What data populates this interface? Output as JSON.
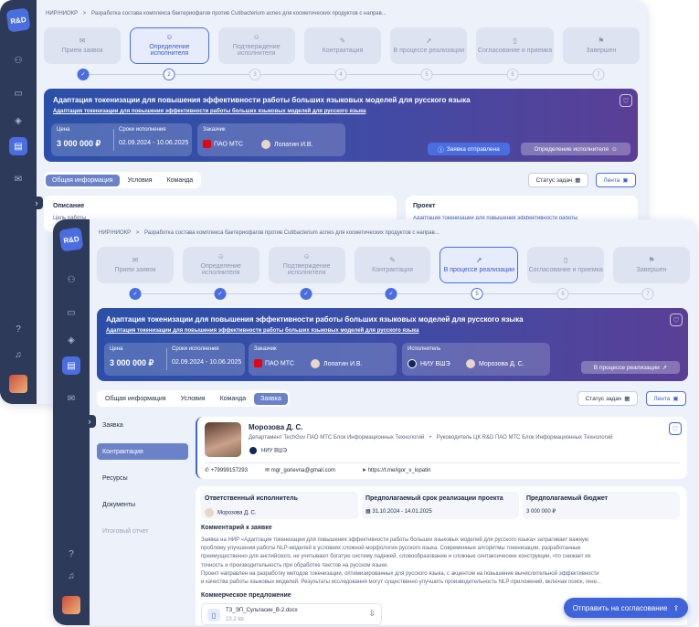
{
  "app": {
    "logo": "R&D"
  },
  "breadcrumb": {
    "root": "НИР/НИОКР",
    "sep": ">",
    "current": "Разработка состава комплекса бактериофагов против Cutibacterium acnes для косметических продуктов с напрaв..."
  },
  "steps": [
    {
      "label": "Прием заявок",
      "icon": "envelope-icon"
    },
    {
      "label": "Определение исполнителя",
      "icon": "user-icon"
    },
    {
      "label": "Подтверждение исполнителя",
      "icon": "user-check-icon"
    },
    {
      "label": "Контрактация",
      "icon": "contract-icon"
    },
    {
      "label": "В процессе реализации",
      "icon": "rocket-icon"
    },
    {
      "label": "Согласование и приемка",
      "icon": "document-icon"
    },
    {
      "label": "Завершен",
      "icon": "flag-icon"
    }
  ],
  "step_numbers": [
    "1",
    "2",
    "3",
    "4",
    "5",
    "6",
    "7"
  ],
  "project": {
    "title": "Адаптация токенизации для повышения эффективности работы больших языковых моделей для русского языка",
    "subtitle": "Адаптация токенизации для повышения эффективности работы больших языковых моделей для русского языка",
    "price_label": "Цена",
    "price": "3 000 000 ₽",
    "dates_label": "Сроки исполнения",
    "dates": "02.09.2024 - 10.06.2025",
    "customer_label": "Заказчик",
    "customer_org": "ПАО МТС",
    "customer_person": "Лопатин И.В.",
    "executor_label": "Исполнитель",
    "executor_org": "НИУ ВШЭ",
    "executor_person": "Морозова Д. С."
  },
  "back": {
    "status_sent": "Заявка отправлена",
    "define_executor": "Определение исполнителя",
    "tabs": [
      "Общая информация",
      "Условия",
      "Команда"
    ],
    "description_label": "Описание",
    "goal_label": "Цель работы",
    "project_label": "Проект",
    "project_link": "Адаптация токенизации для повышения эффективности работы"
  },
  "front": {
    "status_pill": "В процессе реализации",
    "tabs": [
      "Общая информация",
      "Условия",
      "Команда",
      "Заявка"
    ],
    "left_nav": [
      "Заявка",
      "Контрактация",
      "Ресурсы",
      "Документы",
      "Итоговый отчет"
    ]
  },
  "toolbar": {
    "tasks_status": "Статус задач",
    "feed": "Лента"
  },
  "applicant": {
    "name": "Морозова Д. С.",
    "department": "Департамент TechGov ПАО МТС Блок Информационных Технологий",
    "role": "Руководитель ЦК R&D ПАО МТС Блок Информационных Технологий",
    "org": "НИУ ВШЭ",
    "phone": "+79999157293",
    "email": "mgr_gorievna@gmail.com",
    "telegram": "https://t.me/igor_v_lopatin"
  },
  "details": {
    "resp_label": "Ответственный исполнитель",
    "resp_value": "Морозова Д. С.",
    "term_label": "Предполагаемый срок реализации проекта",
    "term_value": "31.10.2024 - 14.01.2025",
    "budget_label": "Предполагаемый бюджет",
    "budget_value": "3 000 000 ₽",
    "comment_label": "Комментарий к заявке",
    "comment_lines": [
      "Заявка на НИР «Адаптация токенизации для повышения эффективности работы больших языковых моделей для русского языка» затрагивает важную",
      "проблему улучшения работы NLP-моделей в условиях сложной морфологии русского языка. Современные алгоритмы токенизации, разработанные",
      "преимущественно для английского, не учитывают богатую систему падежей, словообразование и сложные синтаксические конструкции, что снижает их",
      "точность и производительность при обработке текстов на русском языке.",
      "Проект направлен на разработку методов токенизации, оптимизированных для русского языка, с акцентом на повышение вычислительной эффективности",
      "и качества работы языковых моделей. Результаты исследования могут существенно улучшить производительность NLP-приложений, включая поиск, гене..."
    ],
    "offer_label": "Коммерческое предложение",
    "file_name": "ТЗ_ЭП_Сультасин_В-2.docx",
    "file_size": "23.2 kb"
  },
  "actions": {
    "submit": "Отправить на согласование"
  }
}
